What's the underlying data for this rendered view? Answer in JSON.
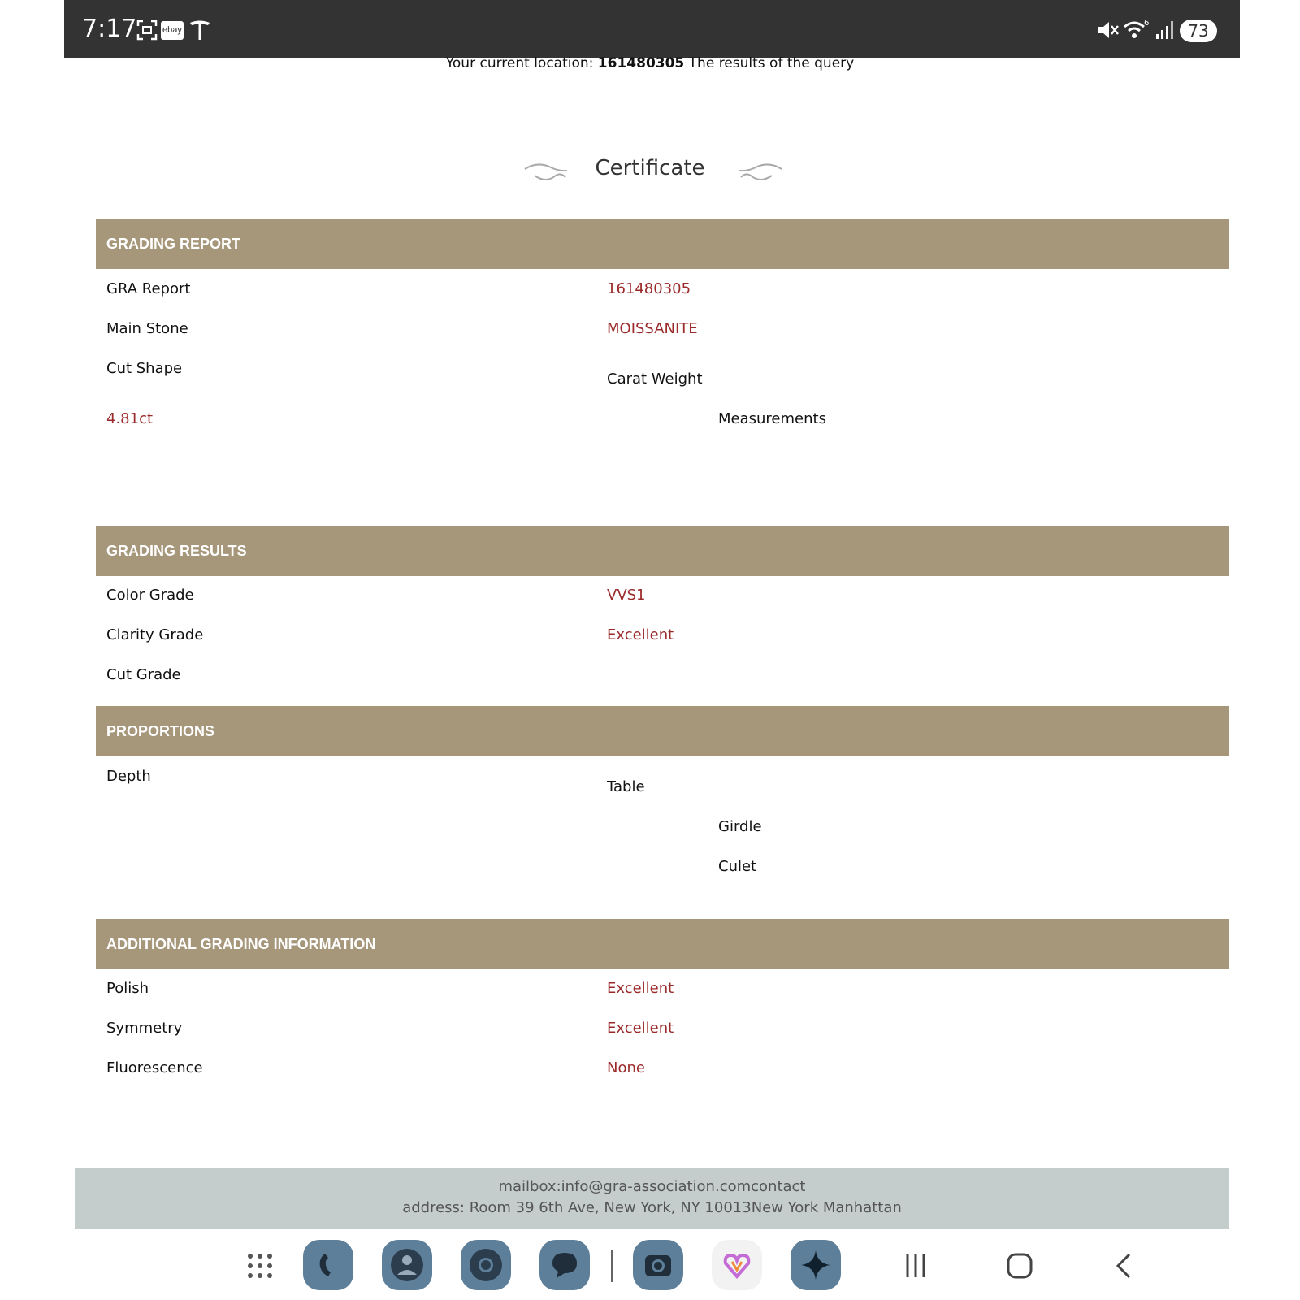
{
  "status_bar": {
    "time": "7:17",
    "ebay_label": "ebay",
    "battery": "73"
  },
  "location": {
    "prefix": "Your current location: ",
    "report_id": "161480305",
    "suffix": " The results of the query"
  },
  "title": "Certificate",
  "sections": {
    "grading_report": {
      "header": "GRADING REPORT",
      "gra_report_label": "GRA Report",
      "gra_report_value": "161480305",
      "main_stone_label": "Main Stone",
      "main_stone_value": "MOISSANITE",
      "cut_shape_label": "Cut Shape",
      "carat_weight_label": "Carat Weight",
      "carat_value": "4.81ct",
      "measurements_label": "Measurements"
    },
    "grading_results": {
      "header": "GRADING RESULTS",
      "color_grade_label": "Color Grade",
      "color_grade_value": "VVS1",
      "clarity_grade_label": "Clarity Grade",
      "clarity_grade_value": "Excellent",
      "cut_grade_label": "Cut Grade"
    },
    "proportions": {
      "header": "PROPORTIONS",
      "depth_label": "Depth",
      "table_label": "Table",
      "girdle_label": "Girdle",
      "culet_label": "Culet"
    },
    "additional": {
      "header": "ADDITIONAL GRADING INFORMATION",
      "polish_label": "Polish",
      "polish_value": "Excellent",
      "symmetry_label": "Symmetry",
      "symmetry_value": "Excellent",
      "fluorescence_label": "Fluorescence",
      "fluorescence_value": "None"
    }
  },
  "footer": {
    "line1": "mailbox:info@gra-association.comcontact",
    "line2": "address: Room 39 6th Ave, New York, NY 10013New York Manhattan"
  },
  "colors": {
    "section_bar": "#a6967a",
    "value_text": "#9b2a2a",
    "footer_bg": "#c4cccc",
    "status_bar": "#333333",
    "dock_icon": "#5e7f9a"
  },
  "dock_icons": [
    "app-drawer-icon",
    "phone-icon",
    "contacts-icon",
    "chrome-icon",
    "messages-icon",
    "camera-icon",
    "health-icon",
    "assistant-icon"
  ],
  "nav_icons": [
    "recents-icon",
    "home-icon",
    "back-icon"
  ]
}
